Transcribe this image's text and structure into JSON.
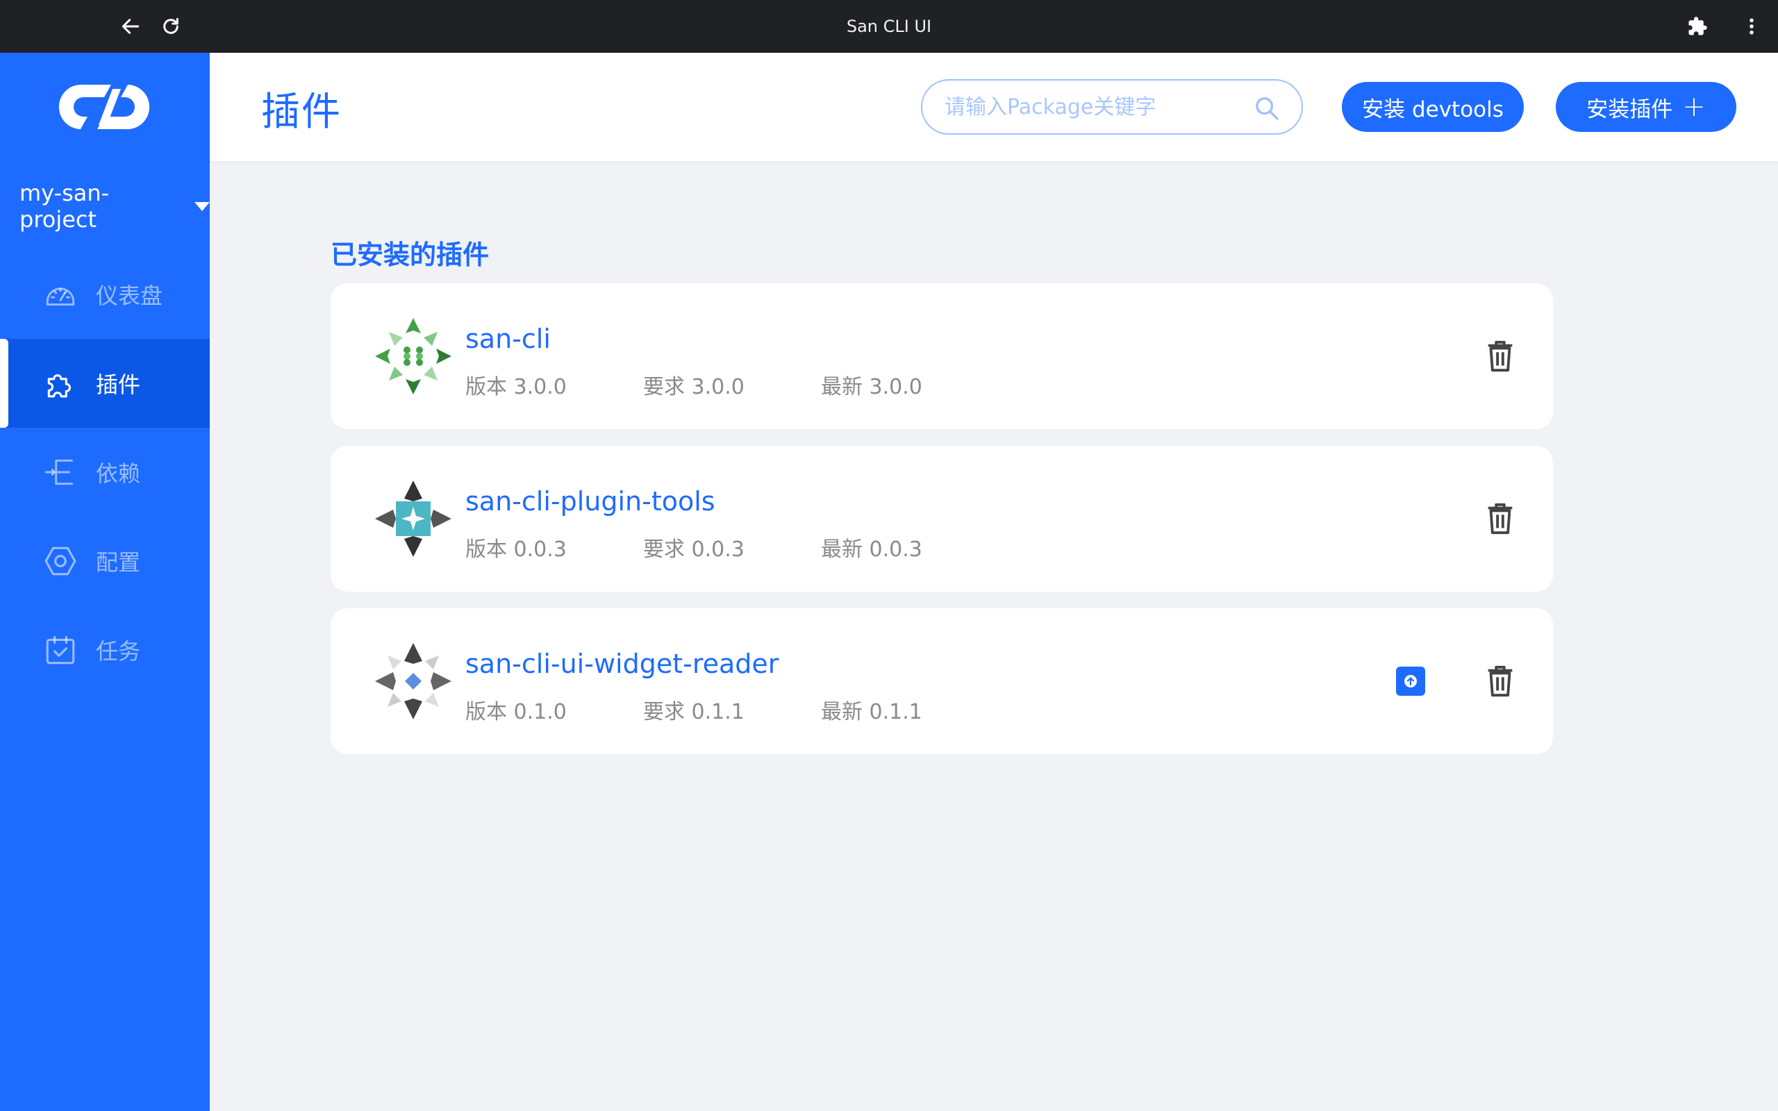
{
  "browser": {
    "title": "San CLI UI"
  },
  "sidebar": {
    "project": "my-san-project",
    "items": [
      {
        "label": "仪表盘",
        "icon": "dashboard-icon"
      },
      {
        "label": "插件",
        "icon": "puzzle-icon",
        "active": true
      },
      {
        "label": "依赖",
        "icon": "dependency-icon"
      },
      {
        "label": "配置",
        "icon": "config-hexagon-icon"
      },
      {
        "label": "任务",
        "icon": "task-calendar-icon"
      }
    ]
  },
  "header": {
    "title": "插件",
    "search_placeholder": "请输入Package关键字",
    "btn_devtools": "安装 devtools",
    "btn_install": "安装插件",
    "btn_install_icon": "+"
  },
  "main": {
    "section_title": "已安装的插件",
    "plugins": [
      {
        "name": "san-cli",
        "version": "版本 3.0.0",
        "required": "要求 3.0.0",
        "latest": "最新 3.0.0",
        "has_update": false
      },
      {
        "name": "san-cli-plugin-tools",
        "version": "版本 0.0.3",
        "required": "要求 0.0.3",
        "latest": "最新 0.0.3",
        "has_update": false
      },
      {
        "name": "san-cli-ui-widget-reader",
        "version": "版本 0.1.0",
        "required": "要求 0.1.1",
        "latest": "最新 0.1.1",
        "has_update": true
      }
    ]
  },
  "colors": {
    "primary": "#1e6bff",
    "sidebar_active": "#0b58e6",
    "background": "#f0f2f5",
    "titlebar": "#202124"
  }
}
